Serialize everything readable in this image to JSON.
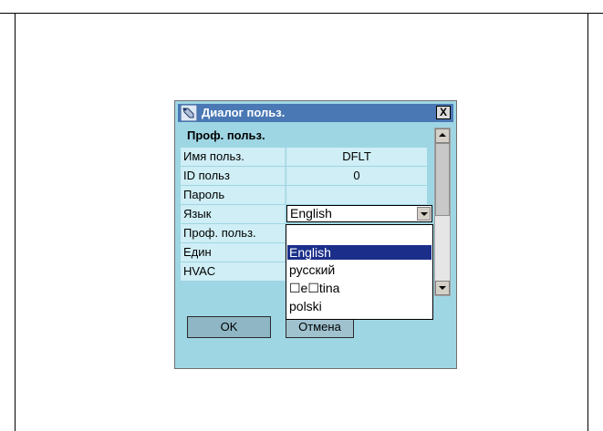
{
  "dialog": {
    "title": "Диалог польз.",
    "close_label": "X",
    "section_title": "Проф. польз."
  },
  "rows": [
    {
      "label": "Имя польз.",
      "value": "DFLT"
    },
    {
      "label": "ID польз",
      "value": "0"
    },
    {
      "label": "Пароль",
      "value": ""
    },
    {
      "label": "Язык",
      "value": "English"
    },
    {
      "label": "Проф. польз.",
      "value": ""
    },
    {
      "label": "Един",
      "value": ""
    },
    {
      "label": "HVAC",
      "value": ""
    }
  ],
  "language_dropdown": {
    "selected": "English",
    "options": [
      "English",
      "русский",
      "☐e☐tina",
      "polski"
    ]
  },
  "buttons": {
    "ok": "OK",
    "cancel": "Отмена"
  },
  "colors": {
    "dialog_bg": "#9fd6e4",
    "titlebar": "#4a78b5",
    "selection": "#1b2f8a"
  }
}
